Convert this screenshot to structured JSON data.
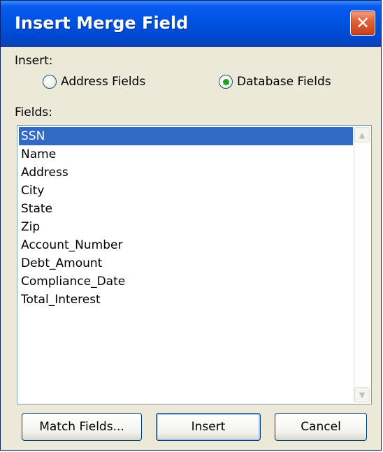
{
  "window": {
    "title": "Insert Merge Field",
    "close_icon": "close-icon"
  },
  "insert_section": {
    "label": "Insert:",
    "options": [
      {
        "label": "Address Fields",
        "selected": false
      },
      {
        "label": "Database Fields",
        "selected": true
      }
    ]
  },
  "fields": {
    "label": "Fields:",
    "items": [
      "SSN",
      "Name",
      "Address",
      "City",
      "State",
      "Zip",
      "Account_Number",
      "Debt_Amount",
      "Compliance_Date",
      "Total_Interest"
    ],
    "selected_index": 0
  },
  "buttons": {
    "match_fields": "Match Fields...",
    "insert": "Insert",
    "cancel": "Cancel"
  },
  "colors": {
    "title_bar": "#0054e3",
    "selection": "#316ac5",
    "dialog_bg": "#ece9d8",
    "close_button": "#e2643a"
  }
}
